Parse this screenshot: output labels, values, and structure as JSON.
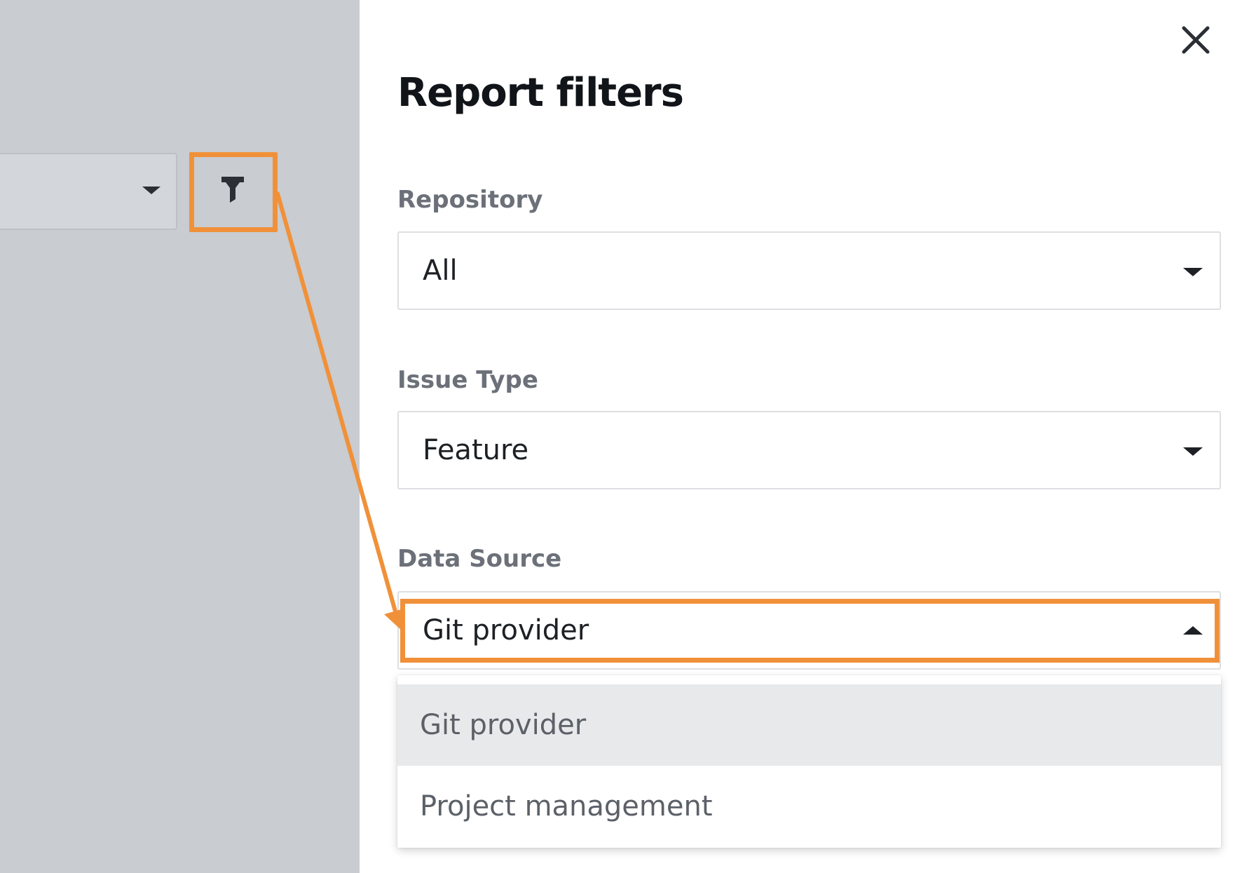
{
  "panel": {
    "title": "Report filters",
    "close_icon": "close-icon"
  },
  "filters": [
    {
      "label": "Repository",
      "value": "All",
      "open": false
    },
    {
      "label": "Issue Type",
      "value": "Feature",
      "open": false
    },
    {
      "label": "Data Source",
      "value": "Git provider",
      "open": true
    }
  ],
  "dropdown": {
    "options": [
      {
        "label": "Git provider",
        "selected": true
      },
      {
        "label": "Project management",
        "selected": false
      }
    ]
  },
  "background": {
    "filter_button_icon": "filter-icon"
  },
  "annotation": {
    "color": "#f0913a"
  }
}
